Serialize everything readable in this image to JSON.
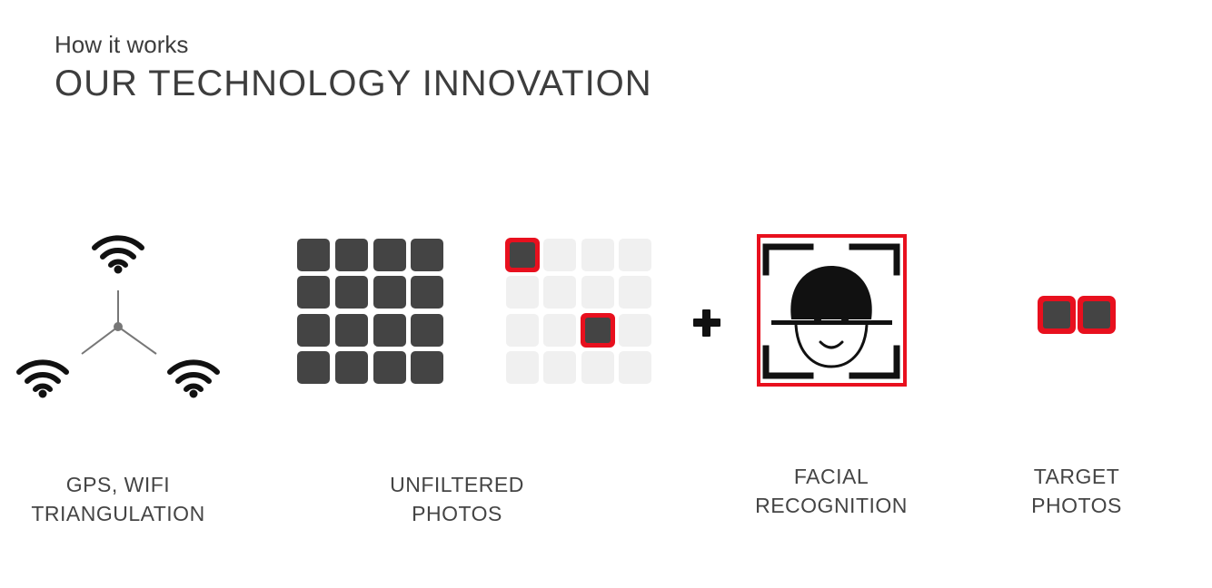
{
  "header": {
    "subtitle": "How it works",
    "title": "OUR TECHNOLOGY INNOVATION"
  },
  "steps": [
    {
      "line1": "GPS, WIFI",
      "line2": "TRIANGULATION",
      "icon": "wifi-triangulation-icon"
    },
    {
      "line1": "UNFILTERED",
      "line2": "PHOTOS",
      "icon": "photo-grid-icon"
    },
    {
      "line1": "FACIAL",
      "line2": "RECOGNITION",
      "icon": "face-scan-icon"
    },
    {
      "line1": "TARGET",
      "line2": "PHOTOS",
      "icon": "target-photos-icon"
    }
  ],
  "operator": "+",
  "colors": {
    "dark": "#444444",
    "light": "#f0f0f0",
    "accent": "#e8101e",
    "text": "#3d3d3d"
  }
}
